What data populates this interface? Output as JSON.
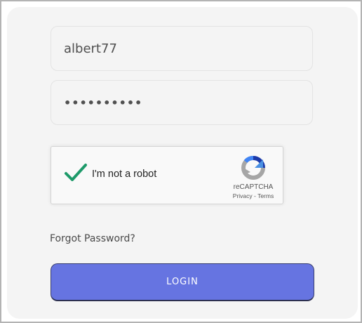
{
  "login_form": {
    "username_value": "albert77",
    "password_value": "••••••••••",
    "forgot_password_label": "Forgot Password?",
    "login_label": "LOGIN",
    "button_color": "#6674e1"
  },
  "recaptcha": {
    "label": "I'm not a robot",
    "brand": "reCAPTCHA",
    "privacy_label": "Privacy",
    "separator": " - ",
    "terms_label": "Terms",
    "checked": true,
    "check_color": "#1e9a6a",
    "logo_icon": "recaptcha-logo-icon",
    "check_icon": "checkmark-icon"
  }
}
